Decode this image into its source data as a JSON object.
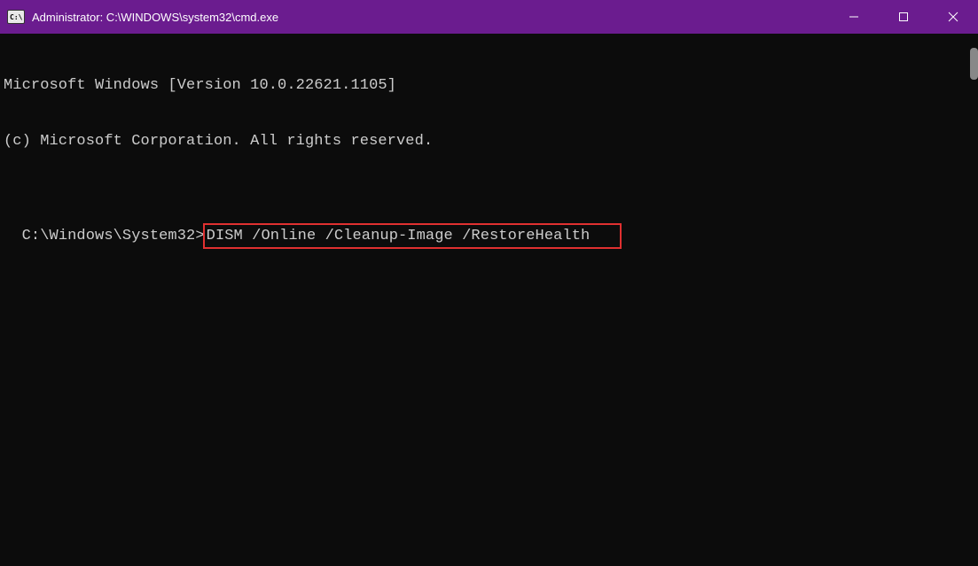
{
  "titlebar": {
    "title": "Administrator: C:\\WINDOWS\\system32\\cmd.exe"
  },
  "terminal": {
    "line1": "Microsoft Windows [Version 10.0.22621.1105]",
    "line2": "(c) Microsoft Corporation. All rights reserved.",
    "prompt_path": "C:\\Windows\\System32",
    "prompt_symbol": ">",
    "command": "DISM /Online /Cleanup-Image /RestoreHealth"
  }
}
